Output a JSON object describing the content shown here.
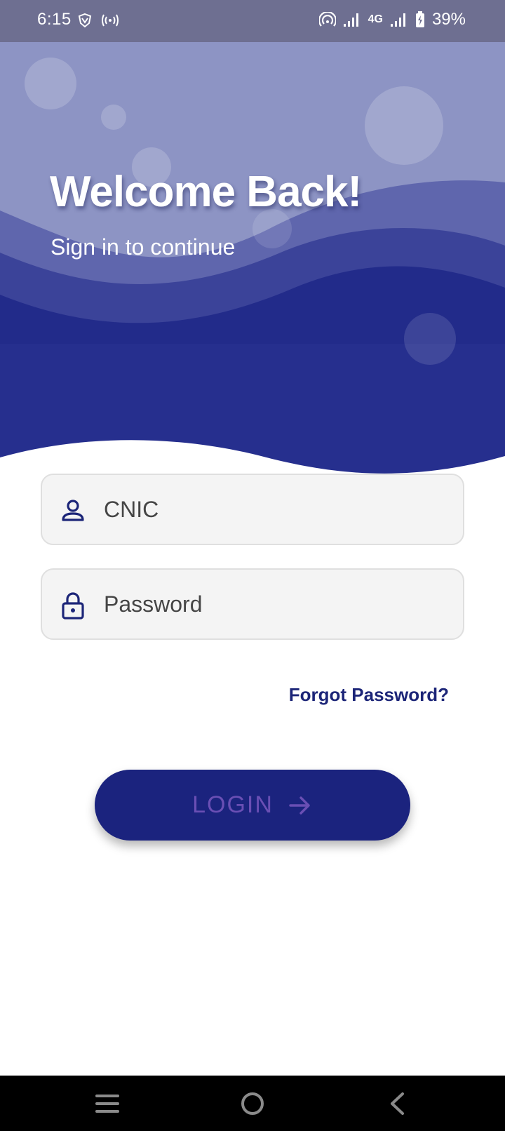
{
  "status_bar": {
    "time": "6:15",
    "network_type": "4G",
    "battery_percent": "39%",
    "left_icons": [
      "vpn-shield-icon",
      "hotspot-signal-icon"
    ],
    "right_icons": [
      "wifi-hotspot-icon",
      "signal-strength-icon",
      "signal-strength-icon",
      "battery-charging-icon"
    ]
  },
  "header": {
    "title": "Welcome Back!",
    "subtitle": "Sign in to continue"
  },
  "form": {
    "cnic": {
      "placeholder": "CNIC",
      "value": "",
      "icon": "person-icon"
    },
    "password": {
      "placeholder": "Password",
      "value": "",
      "icon": "lock-icon"
    },
    "forgot_password_label": "Forgot Password?",
    "login_label": "LOGIN",
    "login_icon": "arrow-right-icon"
  },
  "navigation_bar": {
    "buttons": [
      "menu-icon",
      "home-icon",
      "back-icon"
    ]
  },
  "colors": {
    "status_bar": "#6e6f91",
    "header_light": "#8d94c4",
    "header_dark": "#262f8e",
    "primary": "#1b237e",
    "link": "#1c2578",
    "login_text": "#6a4fb4",
    "field_background": "#f4f4f4",
    "nav_bar": "#000000"
  }
}
